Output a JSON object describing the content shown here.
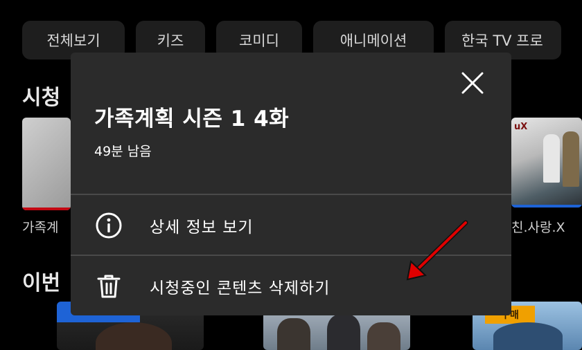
{
  "categories": [
    "전체보기",
    "키즈",
    "코미디",
    "애니메이션",
    "한국 TV 프로"
  ],
  "sections": {
    "watching_title": "시청",
    "this_week_title": "이번"
  },
  "thumbnails": {
    "left_caption": "가족계",
    "right_caption": "친.사랑.X",
    "right_badge": "uX"
  },
  "bottom_row": {
    "badge_right": "구매"
  },
  "modal": {
    "title": "가족계획 시즌 1 4화",
    "subtitle": "49분 남음",
    "items": [
      {
        "label": "상세 정보 보기",
        "icon": "info-icon"
      },
      {
        "label": "시청중인 콘텐츠 삭제하기",
        "icon": "trash-icon"
      }
    ],
    "close_icon": "close-icon"
  },
  "annotation": {
    "arrow_color": "#e00000"
  }
}
